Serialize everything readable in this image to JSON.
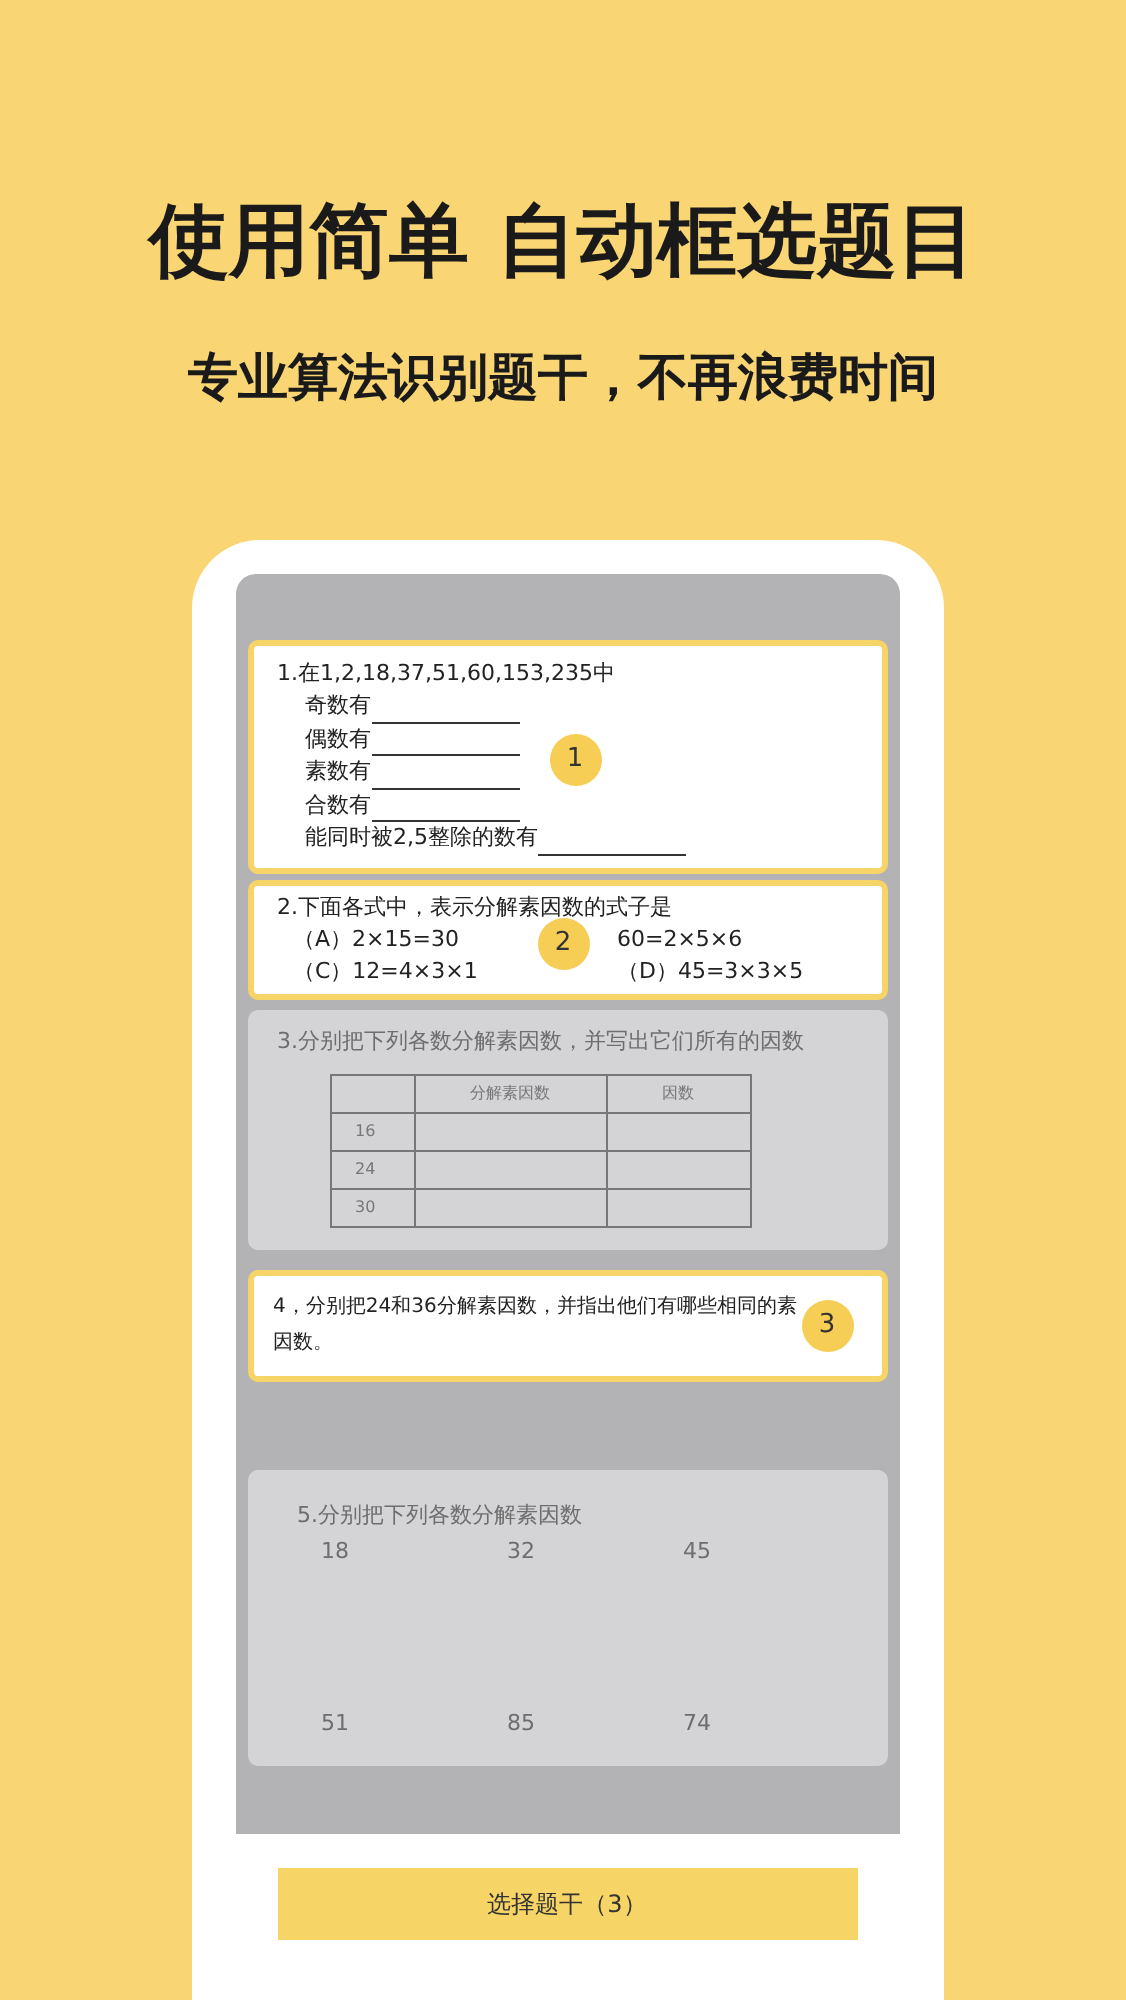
{
  "headline": "使用简单 自动框选题目",
  "subheadline": "专业算法识别题干，不再浪费时间",
  "questions": [
    {
      "kind": "blanks",
      "selected": true,
      "badge": "1",
      "title": "1.在1,2,18,37,51,60,153,235中",
      "items": [
        "奇数有",
        "偶数有",
        "素数有",
        "合数有",
        "能同时被2,5整除的数有"
      ]
    },
    {
      "kind": "options",
      "selected": true,
      "badge": "2",
      "title": "2.下面各式中，表示分解素因数的式子是",
      "options": [
        "（A）2×15=30",
        "60=2×5×6",
        "（C）12=4×3×1",
        "（D）45=3×3×5"
      ]
    },
    {
      "kind": "table",
      "selected": false,
      "title": "3.分别把下列各数分解素因数，并写出它们所有的因数",
      "columns": [
        "分解素因数",
        "因数"
      ],
      "rows": [
        "16",
        "24",
        "30"
      ]
    },
    {
      "kind": "text",
      "selected": true,
      "badge": "3",
      "text": "4，分别把24和36分解素因数，并指出他们有哪些相同的素因数。"
    },
    {
      "kind": "numbers",
      "selected": false,
      "title": "5.分别把下列各数分解素因数",
      "numbers": [
        "18",
        "32",
        "45",
        "51",
        "85",
        "74"
      ]
    }
  ],
  "action_button": "选择题干（3）"
}
